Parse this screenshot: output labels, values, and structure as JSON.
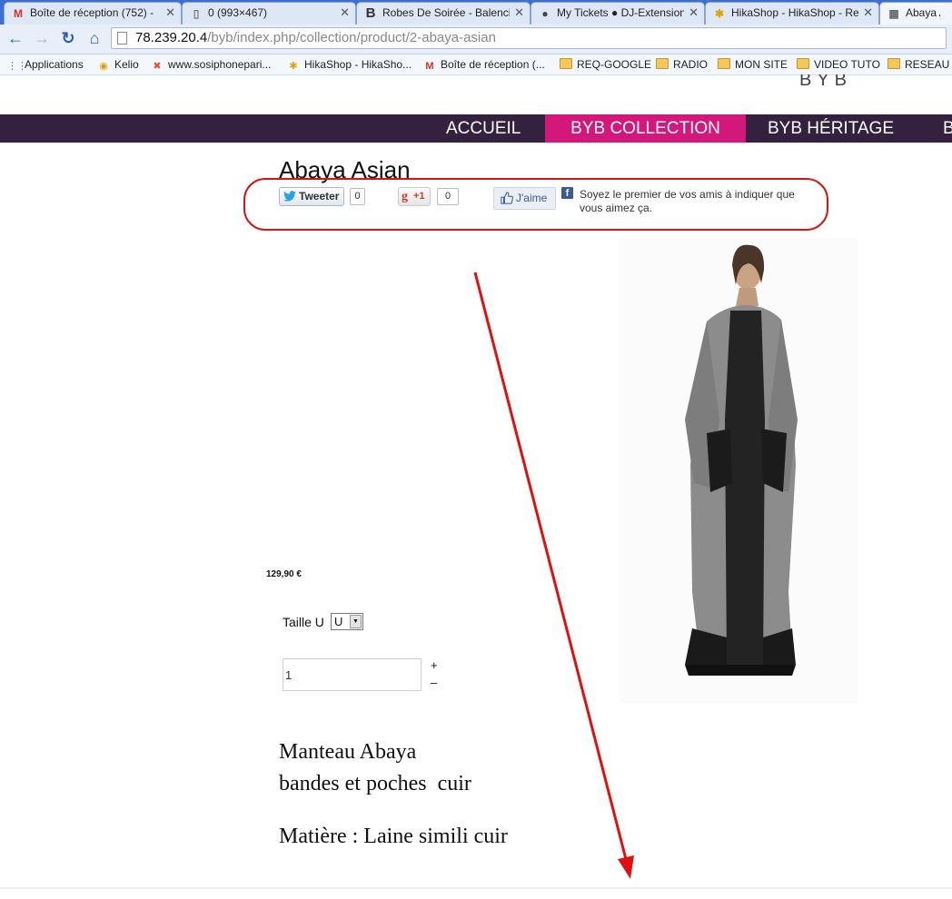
{
  "browser": {
    "tabs": [
      {
        "title": "Boîte de réception (752) -",
        "icon": "gmail-icon"
      },
      {
        "title": "0 (993×467)",
        "icon": "page-icon"
      },
      {
        "title": "Robes De Soirée - Balencia",
        "icon": "b-icon"
      },
      {
        "title": "My Tickets ● DJ-Extension",
        "icon": "dj-icon"
      },
      {
        "title": "HikaShop - HikaShop - Re",
        "icon": "hikashop-icon"
      },
      {
        "title": "Abaya Asi",
        "icon": "site-icon"
      }
    ],
    "url_host": "78.239.20.4",
    "url_path": "/byb/index.php/collection/product/2-abaya-asian",
    "bookmarks": [
      {
        "label": "Applications",
        "icon": "apps-icon"
      },
      {
        "label": "Kelio",
        "icon": "kelio-icon"
      },
      {
        "label": "www.sosiphonepari...",
        "icon": "joomla-icon"
      },
      {
        "label": "HikaShop - HikaSho...",
        "icon": "hikashop-icon"
      },
      {
        "label": "Boîte de réception (...",
        "icon": "gmail-icon"
      },
      {
        "label": "REQ-GOOGLE",
        "icon": "folder-icon"
      },
      {
        "label": "RADIO",
        "icon": "folder-icon"
      },
      {
        "label": "MON SITE",
        "icon": "folder-icon"
      },
      {
        "label": "VIDEO TUTO",
        "icon": "folder-icon"
      },
      {
        "label": "RESEAU S",
        "icon": "folder-icon"
      }
    ]
  },
  "site": {
    "logo_text": "BYB",
    "nav": [
      {
        "label": "ACCUEIL",
        "active": false
      },
      {
        "label": "BYB COLLECTION",
        "active": true
      },
      {
        "label": "BYB HÉRITAGE",
        "active": false
      },
      {
        "label": "B",
        "active": false
      }
    ],
    "nav_color": "#34213f",
    "nav_active_color": "#d4177a"
  },
  "product": {
    "title": "Abaya Asian",
    "social": {
      "tweet_label": "Tweeter",
      "tweet_count": "0",
      "gplus_g": "g",
      "gplus_label": "+1",
      "gplus_count": "0",
      "like_label": "J'aime",
      "fb_text": "Soyez le premier de vos amis à indiquer que vous aimez ça."
    },
    "price": "129,90 €",
    "size_label": "Taille U",
    "size_value": "U",
    "quantity": "1",
    "qty_plus": "+",
    "qty_minus": "–",
    "description": {
      "line1": "Manteau Abaya",
      "line2": "bandes et poches  cuir",
      "line3": "Matière : Laine simili cuir"
    }
  },
  "annotations": {
    "color": "#e01010"
  }
}
